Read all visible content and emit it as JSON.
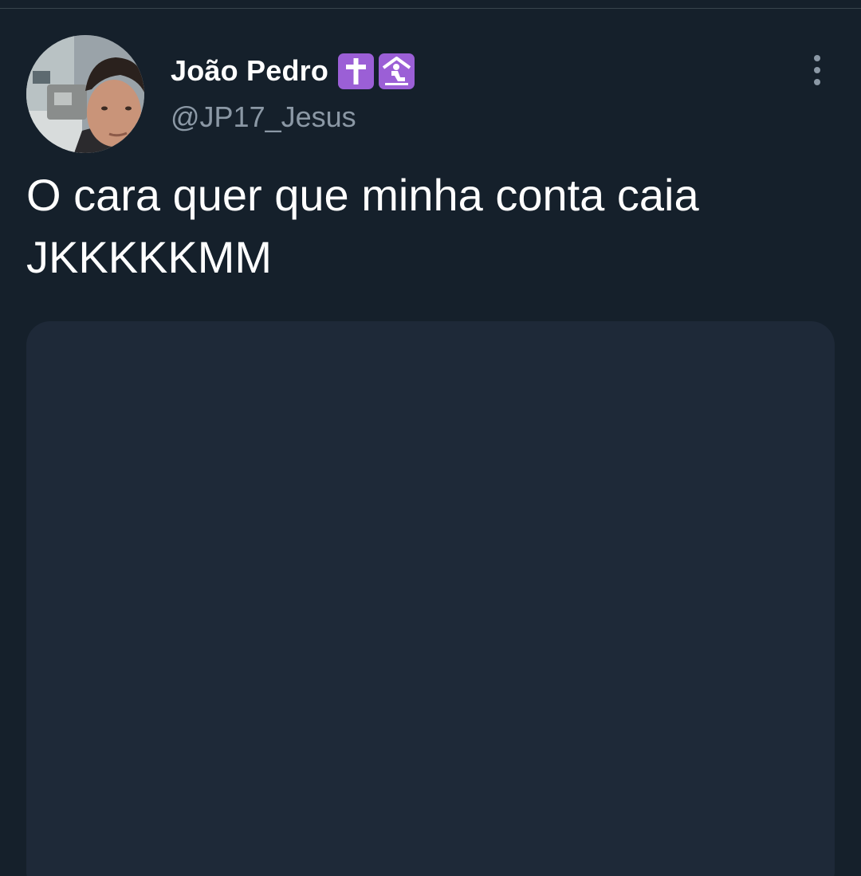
{
  "tweet": {
    "author": {
      "display_name": "João Pedro",
      "handle": "@JP17_Jesus",
      "avatar": "profile-photo",
      "name_emojis": [
        {
          "icon": "latin-cross-icon",
          "color": "#9b5fd6"
        },
        {
          "icon": "place-of-worship-icon",
          "color": "#9b5fd6"
        }
      ]
    },
    "more_icon": "more-options-vertical-icon",
    "text": "O cara quer que minha conta caia\nJKKKKKMM",
    "media": {
      "state": "loading-placeholder",
      "color": "#1e2938"
    }
  },
  "theme": {
    "background": "#15202b",
    "text_primary": "#ffffff",
    "text_secondary": "#8b98a5",
    "divider": "#38444d"
  }
}
